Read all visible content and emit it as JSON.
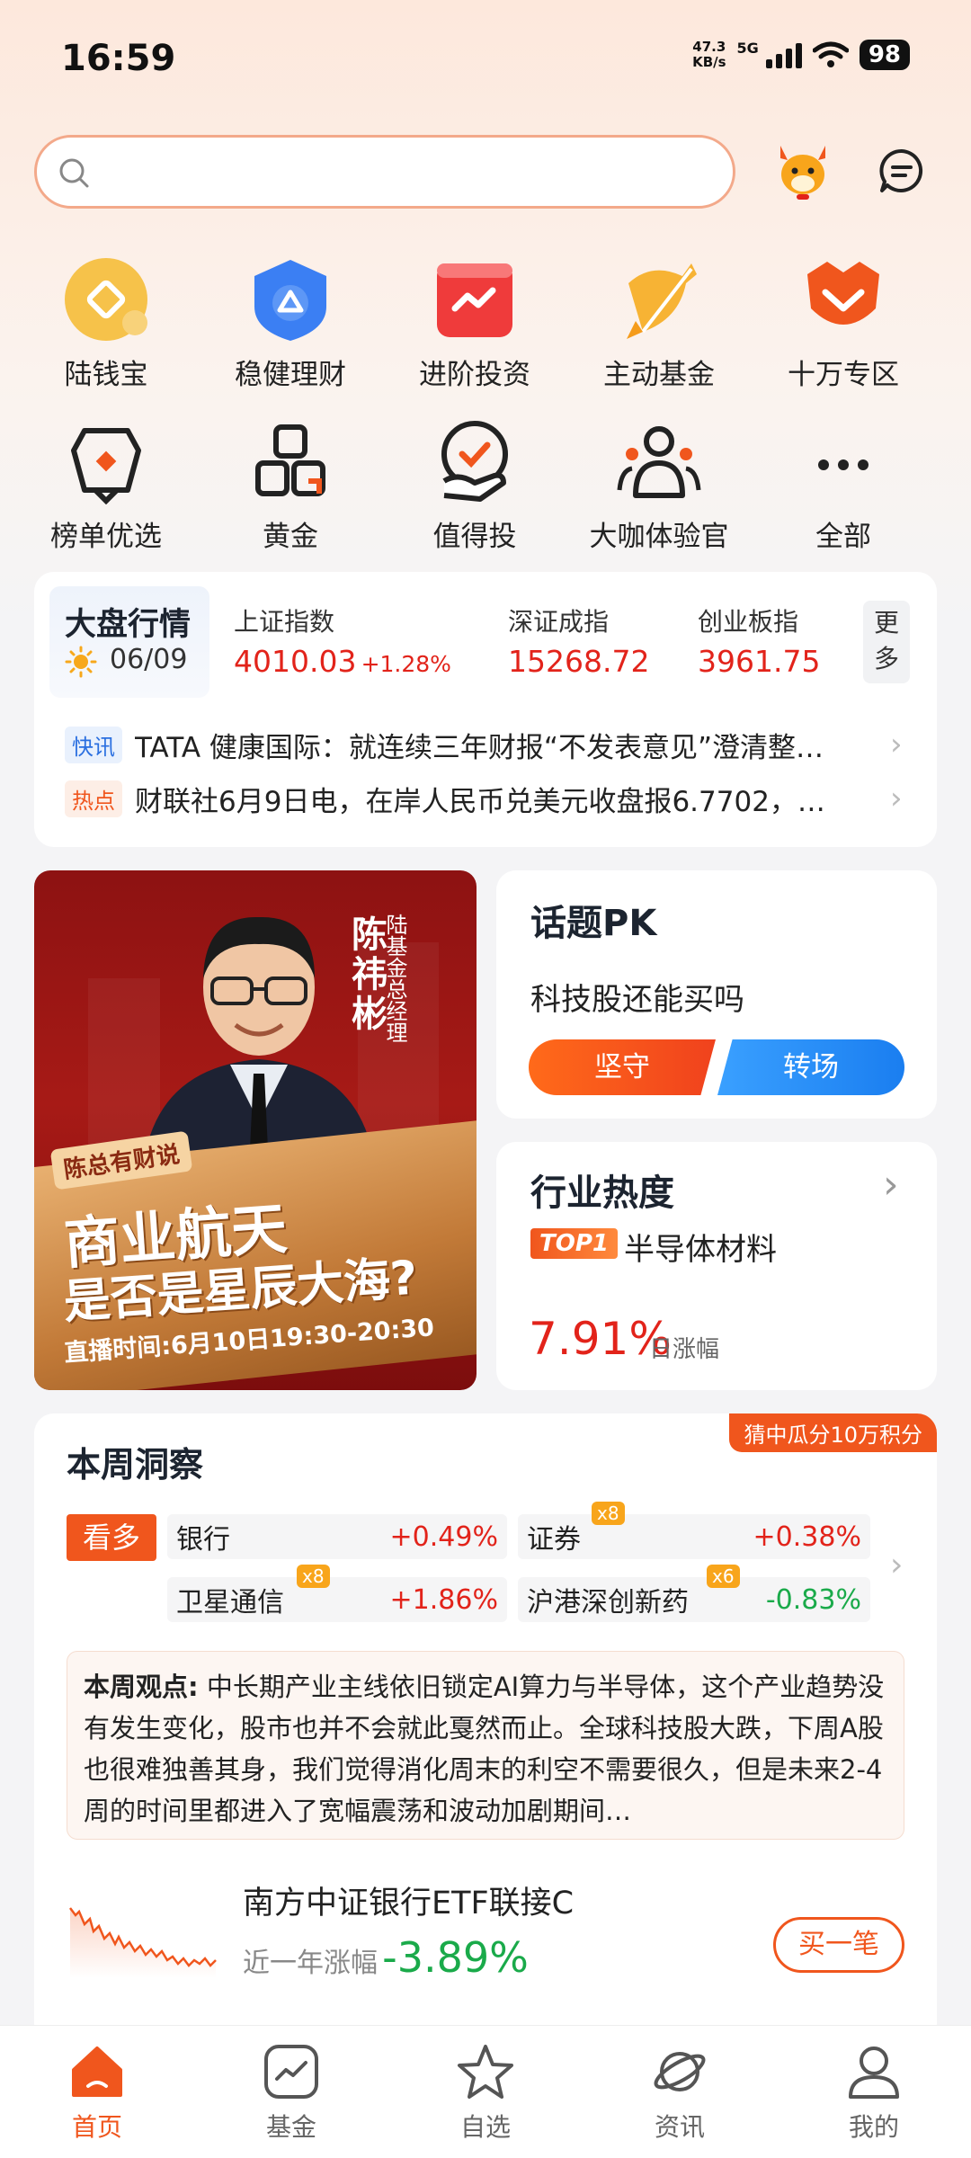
{
  "status_bar": {
    "time": "16:59",
    "speed_value": "47.3",
    "speed_unit": "KB/s",
    "network": "5G",
    "battery": "98"
  },
  "quick_grid": [
    {
      "label": "陆钱宝",
      "icon": "coin-icon"
    },
    {
      "label": "稳健理财",
      "icon": "shield-icon"
    },
    {
      "label": "进阶投资",
      "icon": "chart-icon"
    },
    {
      "label": "主动基金",
      "icon": "target-icon"
    },
    {
      "label": "十万专区",
      "icon": "fox-icon"
    },
    {
      "label": "榜单优选",
      "icon": "trophy-icon"
    },
    {
      "label": "黄金",
      "icon": "gold-bars-icon"
    },
    {
      "label": "值得投",
      "icon": "check-hand-icon"
    },
    {
      "label": "大咖体验官",
      "icon": "people-icon"
    },
    {
      "label": "全部",
      "icon": "more-dots-icon"
    }
  ],
  "market": {
    "title": "大盘行情",
    "date": "06/09",
    "indices": [
      {
        "name": "上证指数",
        "value": "4010.03",
        "change": "+1.28%"
      },
      {
        "name": "深证成指",
        "value": "15268.72",
        "change": ""
      },
      {
        "name": "创业板指",
        "value": "3961.75",
        "change": ""
      }
    ],
    "more_label_1": "更",
    "more_label_2": "多",
    "news": [
      {
        "tag": "快讯",
        "text": "TATA 健康国际：就连续三年财报“不发表意见”澄清整…"
      },
      {
        "tag": "热点",
        "text": "财联社6月9日电，在岸人民币兑美元收盘报6.7702，…"
      }
    ]
  },
  "promo": {
    "name": "陈祎彬",
    "role": "陆基金总经理",
    "tag": "陈总有财说",
    "headline_1": "商业航天",
    "headline_2": "是否是星辰大海?",
    "time_text": "直播时间:6月10日19:30-20:30"
  },
  "topic_pk": {
    "title": "话题PK",
    "question": "科技股还能买吗",
    "option_a": "坚守",
    "option_b": "转场"
  },
  "industry_heat": {
    "title": "行业热度",
    "rank_badge": "TOP1",
    "industry": "半导体材料",
    "value": "7.91%",
    "value_label": "日涨幅"
  },
  "weekly_insight": {
    "title": "本周洞察",
    "ribbon": "猜中瓜分10万积分",
    "stance": "看多",
    "sectors": [
      {
        "name": "银行",
        "change": "+0.49%",
        "multiplier": ""
      },
      {
        "name": "证券",
        "change": "+0.38%",
        "multiplier": "x8"
      },
      {
        "name": "卫星通信",
        "change": "+1.86%",
        "multiplier": "x8"
      },
      {
        "name": "沪港深创新药",
        "change": "-0.83%",
        "multiplier": "x6"
      }
    ],
    "view_label": "本周观点:",
    "view_text": "中长期产业主线依旧锁定AI算力与半导体，这个产业趋势没有发生变化，股市也并不会就此戛然而止。全球科技股大跌，下周A股也很难独善其身，我们觉得消化周末的利空不需要很久，但是未来2-4周的时间里都进入了宽幅震荡和波动加剧期间…",
    "fund": {
      "name": "南方中证银行ETF联接C",
      "return_label": "近一年涨幅",
      "return_value": "-3.89%",
      "buy_label": "买一笔"
    }
  },
  "bottom_nav": [
    {
      "label": "首页",
      "icon": "home-icon",
      "active": true
    },
    {
      "label": "基金",
      "icon": "fund-chart-icon",
      "active": false
    },
    {
      "label": "自选",
      "icon": "star-icon",
      "active": false
    },
    {
      "label": "资讯",
      "icon": "planet-icon",
      "active": false
    },
    {
      "label": "我的",
      "icon": "profile-icon",
      "active": false
    }
  ],
  "colors": {
    "accent": "#f0561d",
    "up": "#e2231a",
    "down": "#1aaa4a",
    "blue": "#1a8cf5"
  }
}
